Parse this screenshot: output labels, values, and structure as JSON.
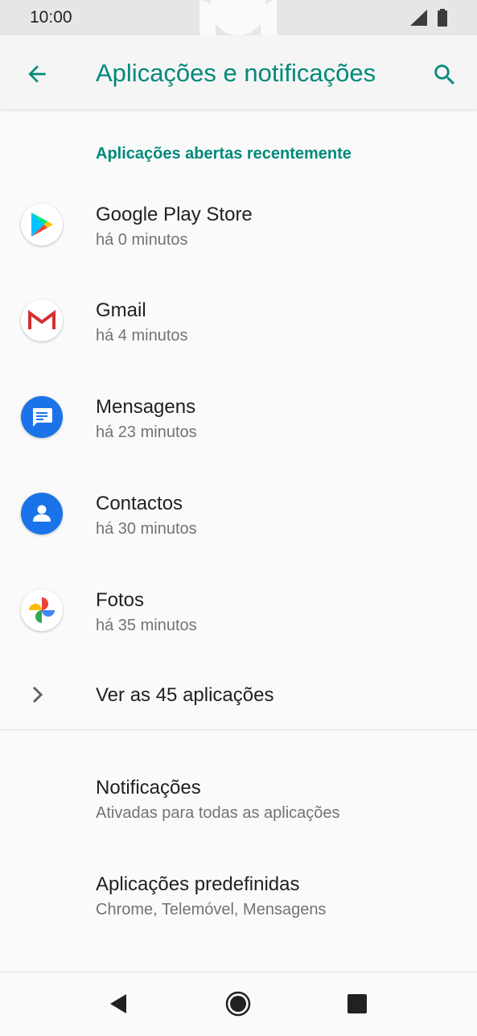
{
  "status_bar": {
    "time": "10:00"
  },
  "app_bar": {
    "title": "Aplicações e notificações"
  },
  "recent": {
    "header": "Aplicações abertas recentemente",
    "apps": [
      {
        "name": "Google Play Store",
        "time": "há 0 minutos",
        "icon": "play-store-icon"
      },
      {
        "name": "Gmail",
        "time": "há 4 minutos",
        "icon": "gmail-icon"
      },
      {
        "name": "Mensagens",
        "time": "há 23 minutos",
        "icon": "messages-icon"
      },
      {
        "name": "Contactos",
        "time": "há 30 minutos",
        "icon": "contacts-icon"
      },
      {
        "name": "Fotos",
        "time": "há 35 minutos",
        "icon": "photos-icon"
      }
    ],
    "see_all": "Ver as 45 aplicações"
  },
  "settings": [
    {
      "title": "Notificações",
      "subtitle": "Ativadas para todas as aplicações"
    },
    {
      "title": "Aplicações predefinidas",
      "subtitle": "Chrome, Telemóvel, Mensagens"
    }
  ],
  "colors": {
    "accent": "#00897b",
    "blue": "#1a73e8"
  }
}
